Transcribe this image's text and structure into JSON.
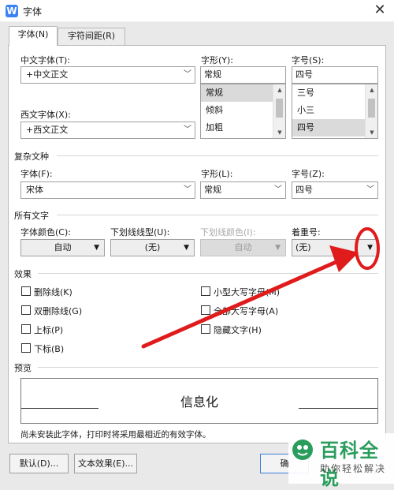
{
  "window": {
    "title": "字体",
    "app_icon_letter": "W",
    "close_glyph": "✕"
  },
  "tabs": [
    {
      "label": "字体(N)",
      "active": true
    },
    {
      "label": "字符间距(R)",
      "active": false
    }
  ],
  "chinese_font": {
    "label": "中文字体(T):",
    "value": "+中文正文"
  },
  "western_font": {
    "label": "西文字体(X):",
    "value": "+西文正文"
  },
  "style": {
    "label": "字形(Y):",
    "value": "常规",
    "options": [
      "常规",
      "倾斜",
      "加粗"
    ],
    "selected": 0
  },
  "size": {
    "label": "字号(S):",
    "value": "四号",
    "options": [
      "三号",
      "小三",
      "四号"
    ],
    "selected": 2
  },
  "complex": {
    "section": "复杂文种",
    "font_label": "字体(F):",
    "font_value": "宋体",
    "style_label": "字形(L):",
    "style_value": "常规",
    "size_label": "字号(Z):",
    "size_value": "四号"
  },
  "all_text": {
    "section": "所有文字",
    "color_label": "字体颜色(C):",
    "color_value": "自动",
    "underline_label": "下划线线型(U):",
    "underline_value": "(无)",
    "underline_color_label": "下划线颜色(I):",
    "underline_color_value": "自动",
    "emphasis_label": "着重号:",
    "emphasis_value": "(无)"
  },
  "effects": {
    "section": "效果",
    "left": [
      "删除线(K)",
      "双删除线(G)",
      "上标(P)",
      "下标(B)"
    ],
    "right": [
      "小型大写字母(M)",
      "全部大写字母(A)",
      "隐藏文字(H)"
    ]
  },
  "preview": {
    "section": "预览",
    "text": "信息化"
  },
  "note": "尚未安装此字体，打印时将采用最相近的有效字体。",
  "buttons": {
    "default": "默认(D)...",
    "text_effect": "文本效果(E)...",
    "ok": "确"
  },
  "annotation": {
    "color": "#e01b1b"
  },
  "watermark": {
    "main": "百科全说",
    "sub": "助你轻松解决"
  }
}
